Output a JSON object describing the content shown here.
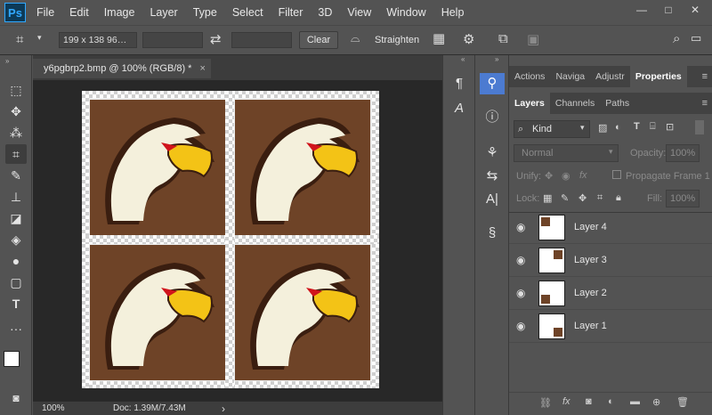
{
  "app": {
    "logo": "Ps"
  },
  "menu": [
    "File",
    "Edit",
    "Image",
    "Layer",
    "Type",
    "Select",
    "Filter",
    "3D",
    "View",
    "Window",
    "Help"
  ],
  "window_controls": [
    "—",
    "□",
    "✕"
  ],
  "options": {
    "ratio_value": "199 x 138 96…",
    "swap_icon": "⇄",
    "clear_label": "Clear",
    "straighten_label": "Straighten"
  },
  "document": {
    "tab_title": "y6pgbrp2.bmp @ 100% (RGB/8) *",
    "close": "×",
    "zoom": "100%",
    "doc_info": "Doc: 1.39M/7.43M",
    "arrow": "›"
  },
  "panels": {
    "top_tabs": [
      "Actions",
      "Naviga",
      "Adjustr",
      "Properties"
    ],
    "layer_tabs": [
      "Layers",
      "Channels",
      "Paths"
    ],
    "filter_kind": "Kind",
    "blend_mode": "Normal",
    "opacity_label": "Opacity:",
    "opacity_value": "100%",
    "unify_label": "Unify:",
    "propagate_label": "Propagate Frame 1",
    "lock_label": "Lock:",
    "fill_label": "Fill:",
    "fill_value": "100%",
    "layers": [
      {
        "name": "Layer 4"
      },
      {
        "name": "Layer 3"
      },
      {
        "name": "Layer 2"
      },
      {
        "name": "Layer 1"
      }
    ],
    "bottom_icons": [
      "link-icon",
      "fx-icon",
      "mask-icon",
      "adjustment-icon",
      "group-icon",
      "new-layer-icon",
      "trash-icon"
    ]
  },
  "colors": {
    "ps_blue": "#31a8ff",
    "tile_brown": "#6e4327",
    "beak_yellow": "#f3c316",
    "eye_red": "#d0141c"
  }
}
